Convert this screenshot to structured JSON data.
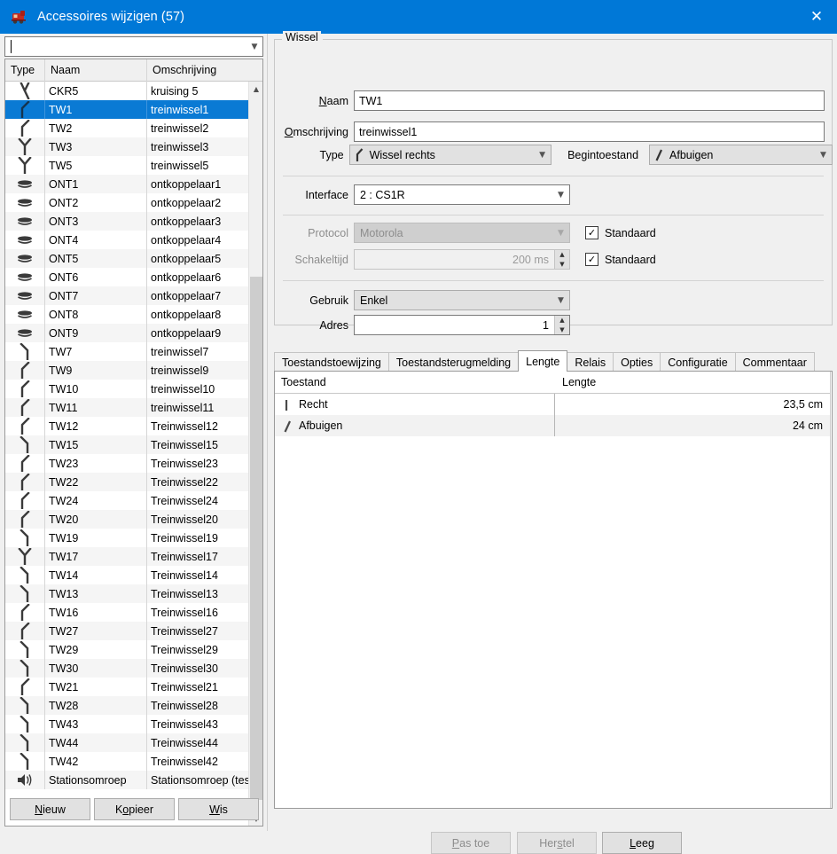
{
  "window": {
    "title": "Accessoires wijzigen (57)",
    "icon": "locomotive-icon",
    "close_label": "✕",
    "titlebar_color": "#0078d7"
  },
  "left_panel": {
    "filter": {
      "value": "",
      "placeholder": ""
    },
    "columns": [
      "Type",
      "Naam",
      "Omschrijving"
    ],
    "rows": [
      {
        "icon": "crossing-icon",
        "naam": "CKR5",
        "omschrijving": "kruising 5",
        "selected": false
      },
      {
        "icon": "turnout-right-icon",
        "naam": "TW1",
        "omschrijving": "treinwissel1",
        "selected": true
      },
      {
        "icon": "turnout-right-icon",
        "naam": "TW2",
        "omschrijving": "treinwissel2",
        "selected": false
      },
      {
        "icon": "turnout-three-way-icon",
        "naam": "TW3",
        "omschrijving": "treinwissel3",
        "selected": false
      },
      {
        "icon": "turnout-three-way-icon",
        "naam": "TW5",
        "omschrijving": "treinwissel5",
        "selected": false
      },
      {
        "icon": "uncoupler-icon",
        "naam": "ONT1",
        "omschrijving": "ontkoppelaar1",
        "selected": false
      },
      {
        "icon": "uncoupler-icon",
        "naam": "ONT2",
        "omschrijving": "ontkoppelaar2",
        "selected": false
      },
      {
        "icon": "uncoupler-icon",
        "naam": "ONT3",
        "omschrijving": "ontkoppelaar3",
        "selected": false
      },
      {
        "icon": "uncoupler-icon",
        "naam": "ONT4",
        "omschrijving": "ontkoppelaar4",
        "selected": false
      },
      {
        "icon": "uncoupler-icon",
        "naam": "ONT5",
        "omschrijving": "ontkoppelaar5",
        "selected": false
      },
      {
        "icon": "uncoupler-icon",
        "naam": "ONT6",
        "omschrijving": "ontkoppelaar6",
        "selected": false
      },
      {
        "icon": "uncoupler-icon",
        "naam": "ONT7",
        "omschrijving": "ontkoppelaar7",
        "selected": false
      },
      {
        "icon": "uncoupler-icon",
        "naam": "ONT8",
        "omschrijving": "ontkoppelaar8",
        "selected": false
      },
      {
        "icon": "uncoupler-icon",
        "naam": "ONT9",
        "omschrijving": "ontkoppelaar9",
        "selected": false
      },
      {
        "icon": "turnout-left-icon",
        "naam": "TW7",
        "omschrijving": "treinwissel7",
        "selected": false
      },
      {
        "icon": "turnout-right-icon",
        "naam": "TW9",
        "omschrijving": "treinwissel9",
        "selected": false
      },
      {
        "icon": "turnout-right-icon",
        "naam": "TW10",
        "omschrijving": "treinwissel10",
        "selected": false
      },
      {
        "icon": "turnout-right-icon",
        "naam": "TW11",
        "omschrijving": "treinwissel11",
        "selected": false
      },
      {
        "icon": "turnout-right-icon",
        "naam": "TW12",
        "omschrijving": "Treinwissel12",
        "selected": false
      },
      {
        "icon": "turnout-left-icon",
        "naam": "TW15",
        "omschrijving": "Treinwissel15",
        "selected": false
      },
      {
        "icon": "turnout-right-icon",
        "naam": "TW23",
        "omschrijving": "Treinwissel23",
        "selected": false
      },
      {
        "icon": "turnout-right-icon",
        "naam": "TW22",
        "omschrijving": "Treinwissel22",
        "selected": false
      },
      {
        "icon": "turnout-right-icon",
        "naam": "TW24",
        "omschrijving": "Treinwissel24",
        "selected": false
      },
      {
        "icon": "turnout-right-icon",
        "naam": "TW20",
        "omschrijving": "Treinwissel20",
        "selected": false
      },
      {
        "icon": "turnout-left-icon",
        "naam": "TW19",
        "omschrijving": "Treinwissel19",
        "selected": false
      },
      {
        "icon": "turnout-three-way-icon",
        "naam": "TW17",
        "omschrijving": "Treinwissel17",
        "selected": false
      },
      {
        "icon": "turnout-left-icon",
        "naam": "TW14",
        "omschrijving": "Treinwissel14",
        "selected": false
      },
      {
        "icon": "turnout-left-icon",
        "naam": "TW13",
        "omschrijving": "Treinwissel13",
        "selected": false
      },
      {
        "icon": "turnout-right-icon",
        "naam": "TW16",
        "omschrijving": "Treinwissel16",
        "selected": false
      },
      {
        "icon": "turnout-right-icon",
        "naam": "TW27",
        "omschrijving": "Treinwissel27",
        "selected": false
      },
      {
        "icon": "turnout-left-icon",
        "naam": "TW29",
        "omschrijving": "Treinwissel29",
        "selected": false
      },
      {
        "icon": "turnout-left-icon",
        "naam": "TW30",
        "omschrijving": "Treinwissel30",
        "selected": false
      },
      {
        "icon": "turnout-right-icon",
        "naam": "TW21",
        "omschrijving": "Treinwissel21",
        "selected": false
      },
      {
        "icon": "turnout-left-icon",
        "naam": "TW28",
        "omschrijving": "Treinwissel28",
        "selected": false
      },
      {
        "icon": "turnout-left-icon",
        "naam": "TW43",
        "omschrijving": "Treinwissel43",
        "selected": false
      },
      {
        "icon": "turnout-left-icon",
        "naam": "TW44",
        "omschrijving": "Treinwissel44",
        "selected": false
      },
      {
        "icon": "turnout-left-icon",
        "naam": "TW42",
        "omschrijving": "Treinwissel42",
        "selected": false
      },
      {
        "icon": "speaker-icon",
        "naam": "Stationsomroep",
        "omschrijving": "Stationsomroep (test)",
        "selected": false
      }
    ],
    "buttons": {
      "nieuw": "Nieuw",
      "kopieer": "Kopieer",
      "wis": "Wis"
    }
  },
  "right_panel": {
    "group_legend": "Wissel",
    "fields": {
      "naam_label": "Naam",
      "naam_value": "TW1",
      "omschrijving_label": "Omschrijving",
      "omschrijving_value": "treinwissel1",
      "type_label": "Type",
      "type_value": "Wissel rechts",
      "begintoestand_label": "Begintoestand",
      "begintoestand_value": "Afbuigen",
      "interface_label": "Interface",
      "interface_value": "2 : CS1R",
      "protocol_label": "Protocol",
      "protocol_value": "Motorola",
      "protocol_standaard": "Standaard",
      "schakeltijd_label": "Schakeltijd",
      "schakeltijd_value": "200 ms",
      "schakeltijd_standaard": "Standaard",
      "gebruik_label": "Gebruik",
      "gebruik_value": "Enkel",
      "adres_label": "Adres",
      "adres_value": "1"
    },
    "tabs": [
      {
        "label": "Toestandstoewijzing",
        "active": false
      },
      {
        "label": "Toestandsterugmelding",
        "active": false
      },
      {
        "label": "Lengte",
        "active": true
      },
      {
        "label": "Relais",
        "active": false
      },
      {
        "label": "Opties",
        "active": false
      },
      {
        "label": "Configuratie",
        "active": false
      },
      {
        "label": "Commentaar",
        "active": false
      }
    ],
    "lengte_table": {
      "columns": [
        "Toestand",
        "Lengte"
      ],
      "rows": [
        {
          "icon": "straight-icon",
          "toestand": "Recht",
          "lengte": "23,5 cm"
        },
        {
          "icon": "diverge-icon",
          "toestand": "Afbuigen",
          "lengte": "24 cm"
        }
      ]
    },
    "buttons": {
      "pas_toe": "Pas toe",
      "herstel": "Herstel",
      "leeg": "Leeg"
    }
  }
}
